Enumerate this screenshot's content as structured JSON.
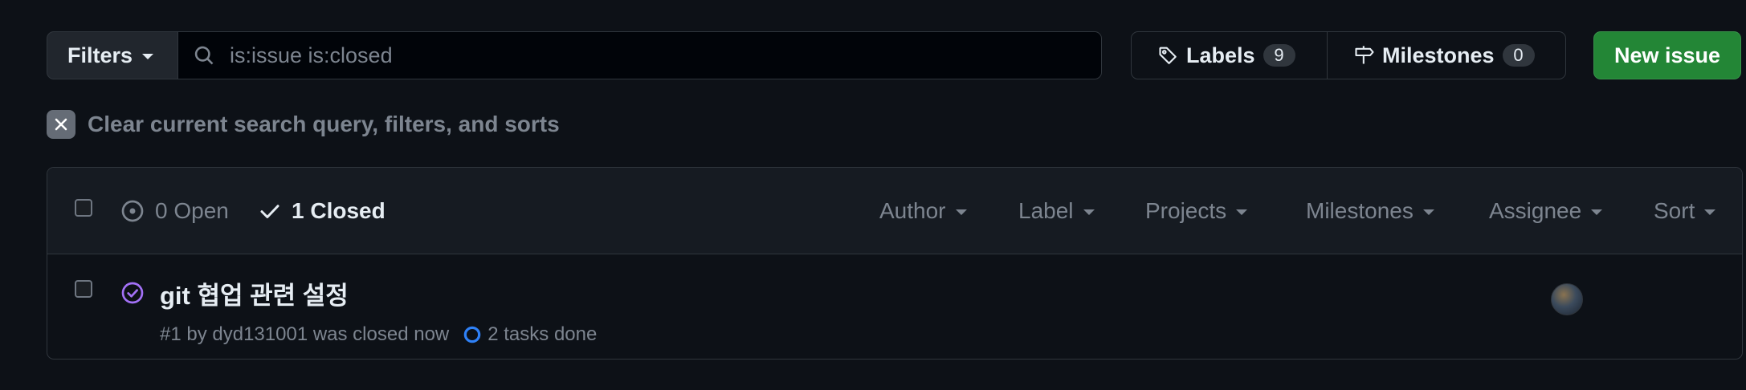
{
  "topbar": {
    "filters_label": "Filters",
    "search_value": "is:issue is:closed",
    "labels_label": "Labels",
    "labels_count": "9",
    "milestones_label": "Milestones",
    "milestones_count": "0",
    "new_issue_label": "New issue"
  },
  "clear_filters": {
    "label": "Clear current search query, filters, and sorts"
  },
  "list_header": {
    "open_label": "0 Open",
    "closed_label": "1 Closed",
    "filters": [
      "Author",
      "Label",
      "Projects",
      "Milestones",
      "Assignee",
      "Sort"
    ]
  },
  "issues": [
    {
      "title": "git 협업 관련 설정",
      "meta": "#1 by dyd131001 was closed now",
      "tasks": "2 tasks done"
    }
  ],
  "colors": {
    "background": "#0d1117",
    "header_bg": "#161b22",
    "primary_button": "#238636",
    "closed_icon": "#a371f7",
    "tasks_ring": "#2f81f7"
  }
}
